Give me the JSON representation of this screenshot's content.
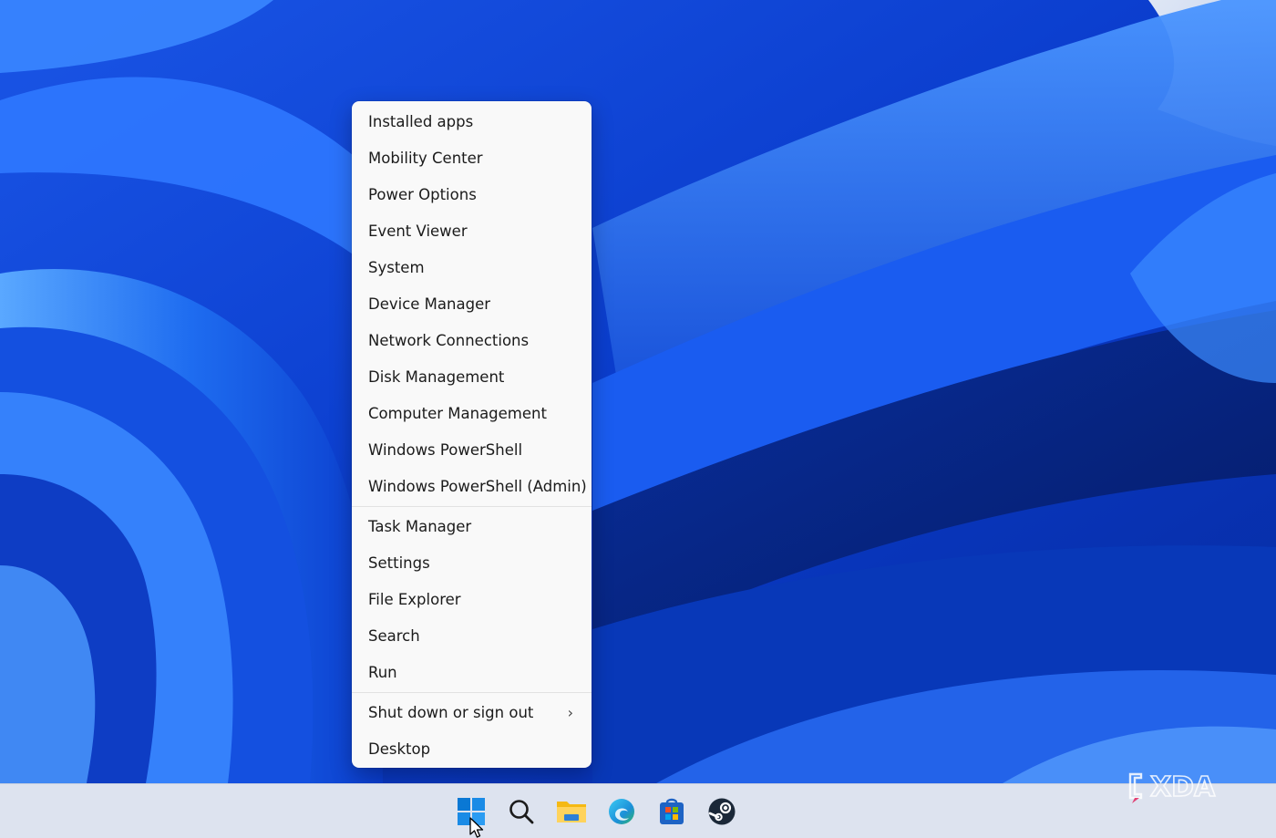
{
  "menu": {
    "items_group1": [
      "Installed apps",
      "Mobility Center",
      "Power Options",
      "Event Viewer",
      "System",
      "Device Manager",
      "Network Connections",
      "Disk Management",
      "Computer Management",
      "Windows PowerShell",
      "Windows PowerShell (Admin)"
    ],
    "items_group2": [
      "Task Manager",
      "Settings",
      "File Explorer",
      "Search",
      "Run"
    ],
    "items_group3": [
      "Shut down or sign out",
      "Desktop"
    ],
    "submenu_chevron": "›"
  },
  "taskbar": {
    "icons": [
      "start-icon",
      "search-icon",
      "file-explorer-icon",
      "edge-icon",
      "microsoft-store-icon",
      "steam-icon"
    ]
  },
  "watermark": {
    "text": "XDA"
  },
  "colors": {
    "menu_bg": "#f9f9f9",
    "taskbar_bg": "#dde3ef",
    "wallpaper_blue": "#0a3fd0",
    "start_blue": "#0a78d4"
  }
}
